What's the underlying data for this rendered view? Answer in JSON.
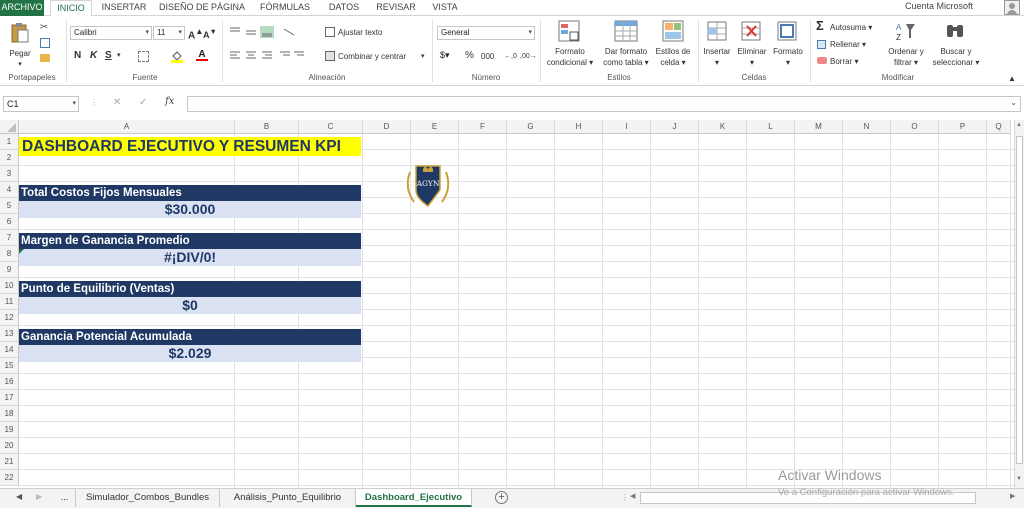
{
  "menu": {
    "file": "ARCHIVO",
    "tabs": [
      "INICIO",
      "INSERTAR",
      "DISEÑO DE PÁGINA",
      "FÓRMULAS",
      "DATOS",
      "REVISAR",
      "VISTA"
    ],
    "account": "Cuenta Microsoft"
  },
  "ribbon": {
    "clipboard": {
      "paste": "Pegar",
      "group": "Portapapeles"
    },
    "font": {
      "name": "Calibri",
      "size": "11",
      "bold": "N",
      "italic": "K",
      "underline": "S",
      "group": "Fuente"
    },
    "alignment": {
      "wrap": "Ajustar texto",
      "merge": "Combinar y centrar",
      "group": "Alineación"
    },
    "number": {
      "format": "General",
      "percent": "%",
      "thousands": "000",
      "group": "Número"
    },
    "styles": {
      "conditional": [
        "Formato",
        "condicional"
      ],
      "table": [
        "Dar formato",
        "como tabla"
      ],
      "cell_styles": [
        "Estilos de",
        "celda"
      ],
      "group": "Estilos"
    },
    "cells": {
      "insert": "Insertar",
      "delete": "Eliminar",
      "format": "Formato",
      "group": "Celdas"
    },
    "editing": {
      "autosum": "Autosuma",
      "fill": "Rellenar",
      "clear": "Borrar",
      "sort": [
        "Ordenar y",
        "filtrar"
      ],
      "find": [
        "Buscar y",
        "seleccionar"
      ],
      "group": "Modificar"
    }
  },
  "formula_bar": {
    "name_box": "C1",
    "fx": "fx",
    "value": ""
  },
  "columns": [
    "A",
    "B",
    "C",
    "D",
    "E",
    "F",
    "G",
    "H",
    "I",
    "J",
    "K",
    "L",
    "M",
    "N",
    "O",
    "P",
    "Q"
  ],
  "rows": [
    "1",
    "2",
    "3",
    "4",
    "5",
    "6",
    "7",
    "8",
    "9",
    "10",
    "11",
    "12",
    "13",
    "14",
    "15",
    "16",
    "17",
    "18",
    "19",
    "20",
    "21",
    "22"
  ],
  "dashboard": {
    "title": "DASHBOARD EJECUTIVO Y RESUMEN KPI",
    "kpis": [
      {
        "label": "Total Costos Fijos Mensuales",
        "value": "$30.000"
      },
      {
        "label": "Margen de Ganancia Promedio",
        "value": "#¡DIV/0!"
      },
      {
        "label": "Punto de Equilibrio (Ventas)",
        "value": "$0"
      },
      {
        "label": "Ganancia Potencial Acumulada",
        "value": "$2.029"
      }
    ],
    "logo_text": "AGYN"
  },
  "sheets": {
    "ellipsis": "...",
    "tabs": [
      "Simulador_Combos_Bundles",
      "Análisis_Punto_Equilibrio",
      "Dashboard_Ejecutivo"
    ],
    "active": "Dashboard_Ejecutivo"
  },
  "watermark": {
    "title": "Activar Windows",
    "subtitle": "Ve a Configuración para activar Windows."
  },
  "colors": {
    "excel_green": "#217346",
    "navy": "#1f3864",
    "light_blue": "#d9e1f2",
    "yellow": "#ffff00"
  }
}
